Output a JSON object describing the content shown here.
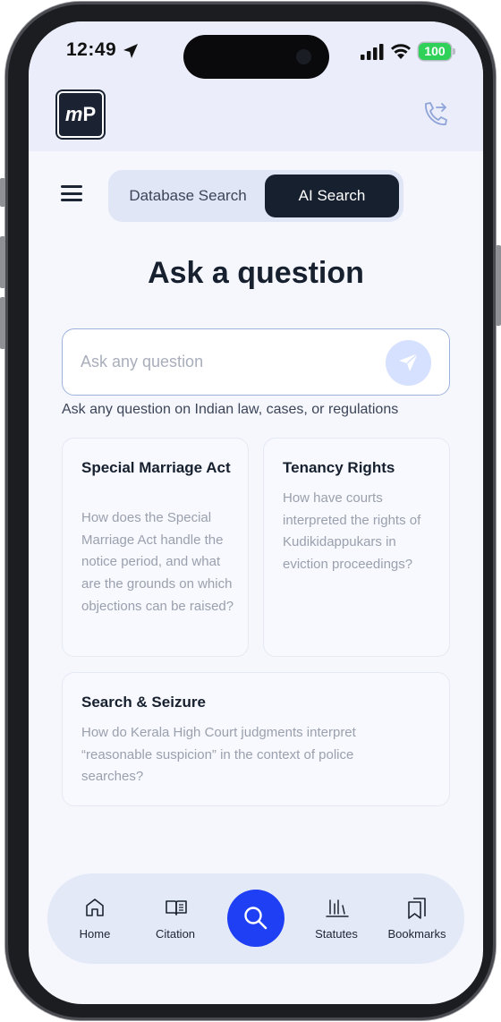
{
  "status_bar": {
    "time": "12:49",
    "battery": "100"
  },
  "header": {
    "logo_text": "mP",
    "icons": [
      "location-arrow-icon",
      "signal-icon",
      "wifi-icon",
      "phone-forward-icon",
      "menu-icon"
    ]
  },
  "segments": {
    "database_label": "Database Search",
    "ai_label": "AI Search",
    "active": "AI Search"
  },
  "main": {
    "title": "Ask a question",
    "search_placeholder": "Ask any question",
    "hint": "Ask any question on Indian law, cases, or regulations"
  },
  "cards": [
    {
      "title": "Special Marriage Act",
      "body": "How does the Special Marriage Act handle the notice period, and what are the grounds on which objections can be raised?"
    },
    {
      "title": "Tenancy Rights",
      "body": "How have courts interpreted the rights of Kudikidappukars in eviction proceedings?"
    },
    {
      "title": "Search & Seizure",
      "body": "How do Kerala High Court judgments interpret “reasonable suspicion” in the context of police searches?"
    }
  ],
  "nav": {
    "home": "Home",
    "citation": "Citation",
    "statutes": "Statutes",
    "bookmarks": "Bookmarks"
  },
  "colors": {
    "accent_blue": "#1f3ff5",
    "dark_navy": "#17202e",
    "battery_green": "#2fd158"
  }
}
